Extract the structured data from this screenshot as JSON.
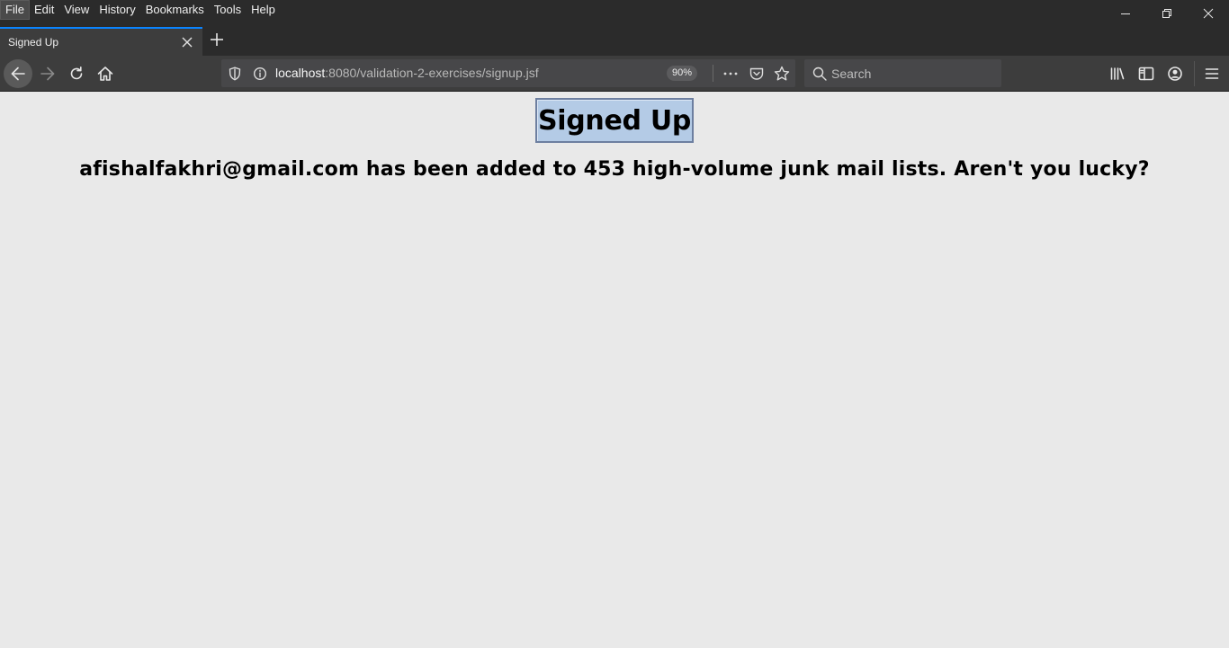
{
  "menu": {
    "items": [
      "File",
      "Edit",
      "View",
      "History",
      "Bookmarks",
      "Tools",
      "Help"
    ]
  },
  "tab": {
    "title": "Signed Up"
  },
  "navbar": {
    "url_host": "localhost",
    "url_rest": ":8080/validation-2-exercises/signup.jsf",
    "zoom": "90%",
    "search_placeholder": "Search"
  },
  "page": {
    "heading": "Signed Up",
    "message": "afishalfakhri@gmail.com has been added to 453 high-volume junk mail lists. Aren't you lucky?"
  },
  "colors": {
    "accent_tab": "#0a84ff",
    "heading_bg": "#b4cbe6",
    "page_bg": "#e9e9e9",
    "toolbar_bg": "#3d3d3d"
  }
}
